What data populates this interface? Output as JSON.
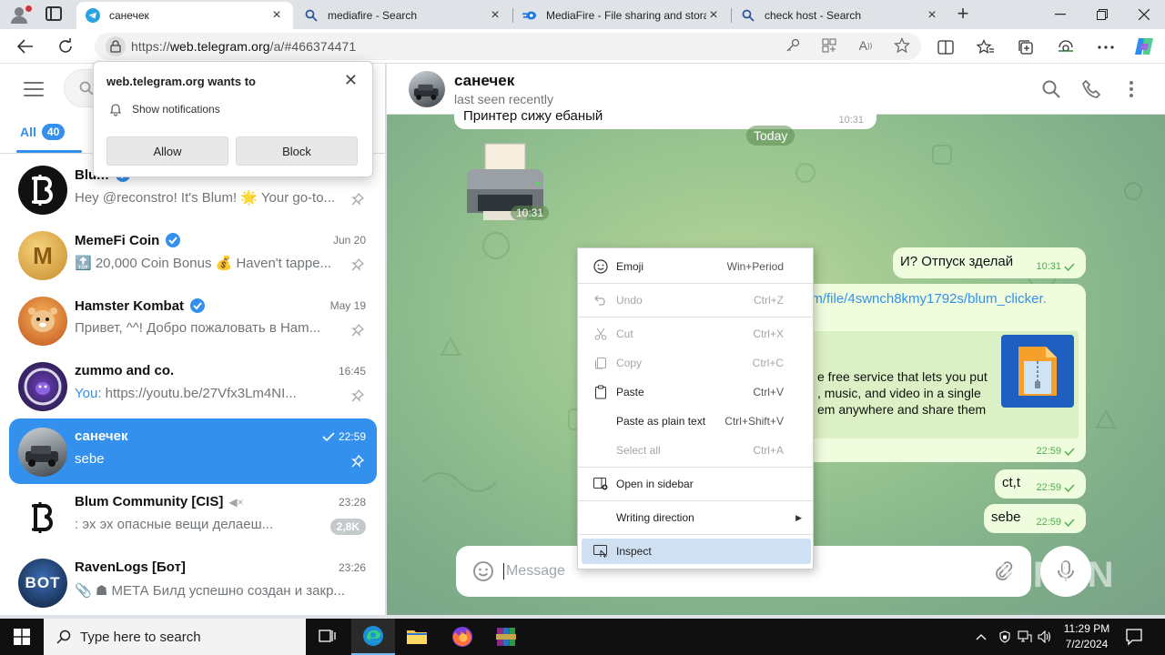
{
  "browser": {
    "tabs": [
      {
        "title": "санечек",
        "favicon": "telegram-icon",
        "active": true
      },
      {
        "title": "mediafire - Search",
        "favicon": "search-icon",
        "active": false
      },
      {
        "title": "MediaFire - File sharing and stora",
        "favicon": "mediafire-icon",
        "active": false
      },
      {
        "title": "check host - Search",
        "favicon": "search-icon",
        "active": false
      }
    ],
    "url_prefix": "https://",
    "url_host": "web.telegram.org",
    "url_rest": "/a/#466374471"
  },
  "permission_popup": {
    "title": "web.telegram.org wants to",
    "request": "Show notifications",
    "allow_label": "Allow",
    "block_label": "Block"
  },
  "telegram": {
    "filter": {
      "label": "All",
      "count": "40"
    },
    "chats": [
      {
        "name": "Blum",
        "time": "",
        "preview": "Hey @reconstro! It's Blum! 🌟 Your go-to...",
        "verified": true,
        "pinned": true,
        "selected": false
      },
      {
        "name": "MemeFi Coin",
        "time": "Jun 20",
        "preview": "🔝 20,000 Coin Bonus 💰 Haven't tappe...",
        "verified": true,
        "pinned": true,
        "selected": false
      },
      {
        "name": "Hamster Kombat",
        "time": "May 19",
        "preview": "Привет, ^^! Добро пожаловать в Ham...",
        "verified": true,
        "pinned": true,
        "selected": false
      },
      {
        "name": "zummo and co.",
        "time": "16:45",
        "preview_prefix": "You:",
        "preview": " https://youtu.be/27Vfx3Lm4NI...",
        "verified": false,
        "pinned": true,
        "selected": false
      },
      {
        "name": "санечек",
        "time": "22:59",
        "preview": "sebe",
        "verified": false,
        "pinned": true,
        "selected": true
      },
      {
        "name": "Blum Community [CIS]",
        "time": "23:28",
        "preview": ": эх эх опасные вещи делаеш...",
        "badge": "2,8K",
        "verified": false,
        "pinned": false,
        "selected": false
      },
      {
        "name": "RavenLogs [Бот]",
        "time": "23:26",
        "preview": "📎 ☗ МЕТА Билд успешно создан и закр...",
        "verified": false,
        "pinned": false,
        "selected": false
      }
    ],
    "header": {
      "name": "санечек",
      "status": "last seen recently"
    },
    "messages": {
      "top_text": "Принтер сижу ебаный",
      "top_time": "10:31",
      "date_chip": "Today",
      "sticker_time": "10:31",
      "out1_text": "И? Отпуск зделай",
      "out1_time": "10:31",
      "link_text": "om/file/4swnch8kmy1792s/blum_clicker.",
      "preview_line1": "e free service that lets you put",
      "preview_line2": ", music, and video in a single",
      "preview_line3": "em anywhere and share them",
      "link_time": "22:59",
      "out2_text": "ct,t",
      "out2_time": "22:59",
      "out3_text": "sebe",
      "out3_time": "22:59"
    },
    "composer_placeholder": "Message"
  },
  "context_menu": {
    "items": [
      {
        "label": "Emoji",
        "shortcut": "Win+Period",
        "disabled": false,
        "icon": "emoji-icon"
      },
      {
        "label": "Undo",
        "shortcut": "Ctrl+Z",
        "disabled": true,
        "icon": "undo-icon"
      },
      {
        "label": "Cut",
        "shortcut": "Ctrl+X",
        "disabled": true,
        "icon": "cut-icon"
      },
      {
        "label": "Copy",
        "shortcut": "Ctrl+C",
        "disabled": true,
        "icon": "copy-icon"
      },
      {
        "label": "Paste",
        "shortcut": "Ctrl+V",
        "disabled": false,
        "icon": "paste-icon"
      },
      {
        "label": "Paste as plain text",
        "shortcut": "Ctrl+Shift+V",
        "disabled": false,
        "icon": ""
      },
      {
        "label": "Select all",
        "shortcut": "Ctrl+A",
        "disabled": true,
        "icon": ""
      },
      {
        "label": "Open in sidebar",
        "shortcut": "",
        "disabled": false,
        "icon": "sidebar-icon"
      },
      {
        "label": "Writing direction",
        "shortcut": "",
        "disabled": false,
        "icon": ""
      },
      {
        "label": "Inspect",
        "shortcut": "",
        "disabled": false,
        "icon": "inspect-icon",
        "highlighted": true
      }
    ]
  },
  "watermark": "ANY RUN",
  "taskbar": {
    "search_placeholder": "Type here to search",
    "time": "11:29 PM",
    "date": "7/2/2024"
  },
  "colors": {
    "accent": "#3390ec",
    "outgoing_bubble": "#effdde",
    "check_green": "#4fae4e"
  }
}
